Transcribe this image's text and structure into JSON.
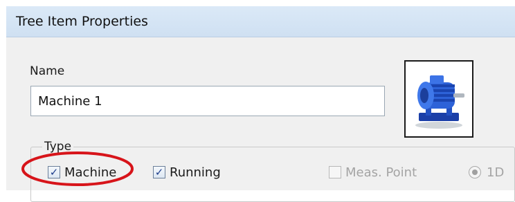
{
  "window": {
    "title": "Tree Item Properties"
  },
  "name_field": {
    "label": "Name",
    "value": "Machine 1"
  },
  "preview": {
    "icon": "electric-motor-icon"
  },
  "type_group": {
    "legend": "Type",
    "options": [
      {
        "label": "Machine",
        "checked": true,
        "enabled": true
      },
      {
        "label": "Running",
        "checked": true,
        "enabled": true
      },
      {
        "label": "Meas. Point",
        "checked": false,
        "enabled": false
      }
    ],
    "radio_1d": {
      "label": "1D",
      "enabled": false
    }
  },
  "annotation": {
    "color": "#d7141a"
  },
  "check_glyph": "✓"
}
